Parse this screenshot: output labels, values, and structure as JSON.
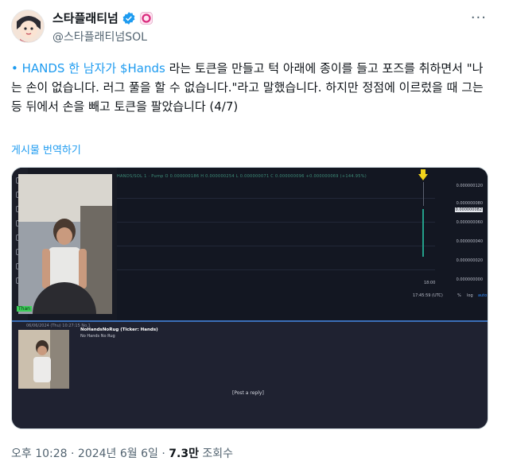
{
  "author": {
    "display_name": "스타플래티넘",
    "handle": "@스타플래티넘SOL"
  },
  "tweet": {
    "text_link": "• HANDS 한 남자가 $Hands",
    "text_rest": " 라는 토큰을 만들고 턱 아래에 종이를 들고 포즈를 취하면서 \"나는 손이 없습니다. 러그 풀을 할 수 없습니다.\"라고 말했습니다. 하지만 정점에 이르렀을 때 그는 등 뒤에서 손을 빼고 토큰을 팔았습니다 (4/7)",
    "translate_label": "게시물 번역하기"
  },
  "media": {
    "ticker_text": "HANDS/SOL 1 · Pump  O 0.000000186  H 0.000000254  L 0.000000071  C 0.000000096  +0.000000069 (+144.95%)",
    "price_labels": [
      "0.000000120",
      "0.000000080",
      "0.000000060",
      "0.000000040",
      "0.000000020",
      "0.000000000"
    ],
    "highlight_price": "0.000000082",
    "time_tick": "18:00",
    "clock": "17:45:59 (UTC)",
    "scale_buttons": [
      "%",
      "log",
      "auto"
    ],
    "cam_badge": "Than",
    "post_meta": "06/06/2024 (Thu) 10:27:15 No.1",
    "post_title": "NoHandsNoRug (Ticker: Hands)",
    "post_subtitle": "No Hands No Rug",
    "reply_label": "[Post a reply]"
  },
  "footer": {
    "time": "오후 10:28",
    "date": "2024년 6월 6일",
    "views_count": "7.3만",
    "views_label": "조회수"
  },
  "colors": {
    "link": "#1d9bf0",
    "muted": "#536471",
    "verified": "#1d9bf0",
    "candle": "#23a08a"
  }
}
